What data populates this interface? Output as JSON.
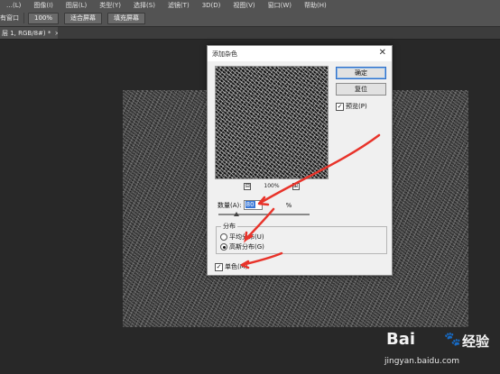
{
  "menu": [
    "…(L)",
    "图像(I)",
    "图层(L)",
    "类型(Y)",
    "选择(S)",
    "滤镜(T)",
    "3D(D)",
    "视图(V)",
    "窗口(W)",
    "帮助(H)"
  ],
  "options_bar": {
    "label": "有窗口",
    "zoom_btn": "100%",
    "fit_btn": "适合屏幕",
    "fill_btn": "填充屏幕"
  },
  "doc_tab": {
    "title": "层 1, RGB/8#) *",
    "close": "×"
  },
  "dialog": {
    "title": "添加杂色",
    "close": "✕",
    "ok": "确定",
    "reset": "复位",
    "preview_label": "预览(P)",
    "preview_checked": true,
    "zoom": {
      "minus": "⊟",
      "value": "100%",
      "plus": "⊞"
    },
    "amount_label": "数量(A):",
    "amount_value": "80",
    "amount_unit": "%",
    "amount_slider_percent": 20,
    "distribution": {
      "legend": "分布",
      "uniform": "平均分布(U)",
      "gaussian": "高斯分布(G)",
      "selected": "gaussian"
    },
    "mono_label": "单色(M)",
    "mono_checked": true
  },
  "watermark": {
    "brand": "Bai",
    "brand2": "经验",
    "url": "jingyan.baidu.com"
  },
  "colors": {
    "accent": "#2f6fc7",
    "arrow": "#e8332a",
    "workspace": "#282828"
  }
}
